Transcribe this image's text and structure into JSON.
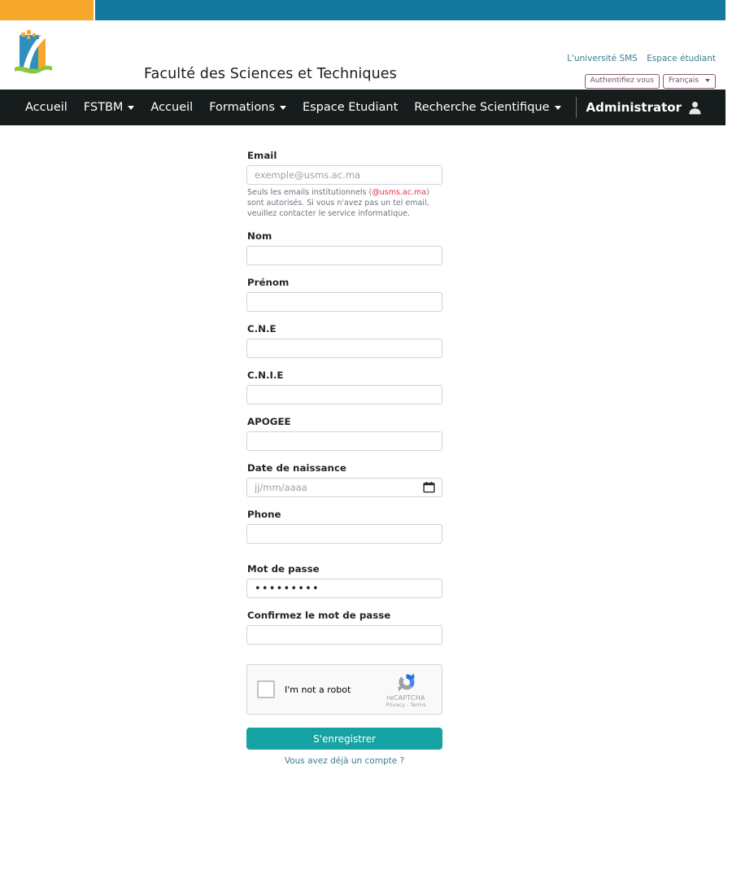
{
  "header": {
    "brand_title": "Faculté des Sciences et Techniques",
    "logo_icon": "fstbm-logo-icon",
    "top_links": [
      {
        "label": "L'université SMS"
      },
      {
        "label": "Espace étudiant"
      }
    ],
    "auth_button": "Authentifiez vous",
    "language_button": "Français",
    "language_caret_icon": "chevron-down-icon"
  },
  "nav": {
    "items": [
      {
        "label": "Accueil",
        "has_caret": false
      },
      {
        "label": "FSTBM",
        "has_caret": true
      },
      {
        "label": "Accueil",
        "has_caret": false
      },
      {
        "label": "Formations",
        "has_caret": true
      },
      {
        "label": "Espace Etudiant",
        "has_caret": false
      },
      {
        "label": "Recherche Scientifique",
        "has_caret": true
      }
    ],
    "user": {
      "label": "Administrator",
      "avatar_icon": "user-avatar-icon",
      "caret_icon": "chevron-down-icon"
    }
  },
  "form": {
    "email": {
      "label": "Email",
      "placeholder": "exemple@usms.ac.ma",
      "value": "",
      "help_before": "Seuls les emails institutionnels (",
      "help_domain": "@usms.ac.ma",
      "help_after": ") sont autorisés. Si vous n'avez pas un tel email, veuillez contacter le service informatique."
    },
    "nom": {
      "label": "Nom",
      "value": "",
      "placeholder": ""
    },
    "prenom": {
      "label": "Prénom",
      "value": "",
      "placeholder": ""
    },
    "cne": {
      "label": "C.N.E",
      "value": "",
      "placeholder": ""
    },
    "cnie": {
      "label": "C.N.I.E",
      "value": "",
      "placeholder": ""
    },
    "apogee": {
      "label": "APOGEE",
      "value": "",
      "placeholder": ""
    },
    "birthdate": {
      "label": "Date de naissance",
      "placeholder": "jj/mm/aaaa",
      "value": "",
      "icon": "calendar-icon"
    },
    "phone": {
      "label": "Phone",
      "value": "",
      "placeholder": ""
    },
    "password": {
      "label": "Mot de passe",
      "value": "•••••••••",
      "placeholder": ""
    },
    "password_confirm": {
      "label": "Confirmez le mot de passe",
      "value": "",
      "placeholder": ""
    },
    "recaptcha": {
      "label": "I'm not a robot",
      "brand": "reCAPTCHA",
      "terms": "Privacy - Terms",
      "logo_icon": "recaptcha-logo-icon",
      "checkbox_icon": "checkbox-icon"
    },
    "submit_label": "S'enregistrer",
    "login_link": "Vous avez déjà un compte ?"
  },
  "colors": {
    "strip_orange": "#f7a82c",
    "strip_blue": "#15789f",
    "nav_dark": "#171c1c",
    "accent_teal": "#16a2a2",
    "link_blue": "#3c7d90",
    "danger_red": "#dc3545",
    "outline_purple": "#8a5a74"
  }
}
